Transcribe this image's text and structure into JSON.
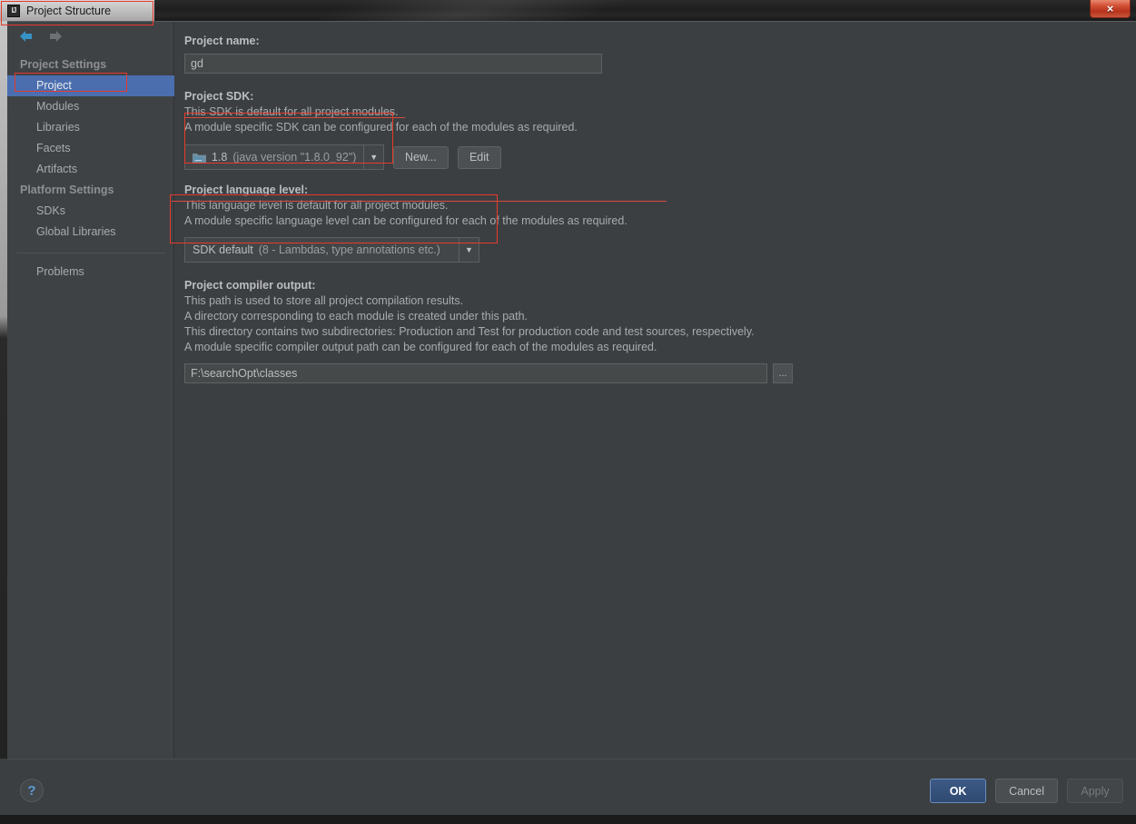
{
  "window": {
    "title": "Project Structure",
    "logo_text": "IJ",
    "close_label": "×"
  },
  "nav": {
    "back_icon": "back-arrow-icon",
    "forward_icon": "forward-arrow-icon"
  },
  "sidebar": {
    "groups": [
      {
        "label": "Project Settings",
        "items": [
          {
            "label": "Project",
            "selected": true
          },
          {
            "label": "Modules",
            "selected": false
          },
          {
            "label": "Libraries",
            "selected": false
          },
          {
            "label": "Facets",
            "selected": false
          },
          {
            "label": "Artifacts",
            "selected": false
          }
        ]
      },
      {
        "label": "Platform Settings",
        "items": [
          {
            "label": "SDKs",
            "selected": false
          },
          {
            "label": "Global Libraries",
            "selected": false
          }
        ]
      }
    ],
    "problems_label": "Problems"
  },
  "main": {
    "project_name": {
      "label": "Project name:",
      "value": "gd"
    },
    "project_sdk": {
      "label": "Project SDK:",
      "desc_line1": "This SDK is default for all project modules.",
      "desc_line2": "A module specific SDK can be configured for each of the modules as required.",
      "selected_version": "1.8",
      "selected_detail": "(java version \"1.8.0_92\")",
      "new_button": "New...",
      "edit_button": "Edit"
    },
    "language_level": {
      "label": "Project language level:",
      "desc_line1": "This language level is default for all project modules.",
      "desc_line2": "A module specific language level can be configured for each of the modules as required.",
      "selected_main": "SDK default",
      "selected_detail": "(8 - Lambdas, type annotations etc.)"
    },
    "compiler_output": {
      "label": "Project compiler output:",
      "desc_line1": "This path is used to store all project compilation results.",
      "desc_line2": "A directory corresponding to each module is created under this path.",
      "desc_line3": "This directory contains two subdirectories: Production and Test for production code and test sources, respectively.",
      "desc_line4": "A module specific compiler output path can be configured for each of the modules as required.",
      "path_value": "F:\\searchOpt\\classes",
      "browse_label": "..."
    }
  },
  "footer": {
    "help_label": "?",
    "ok_label": "OK",
    "cancel_label": "Cancel",
    "apply_label": "Apply"
  },
  "colors": {
    "accent_selection": "#4b6eaf",
    "annotation_red": "#e8392c",
    "background": "#3c3f41",
    "sidebar_background": "#3f4245",
    "primary_button": "#3c5a85"
  }
}
